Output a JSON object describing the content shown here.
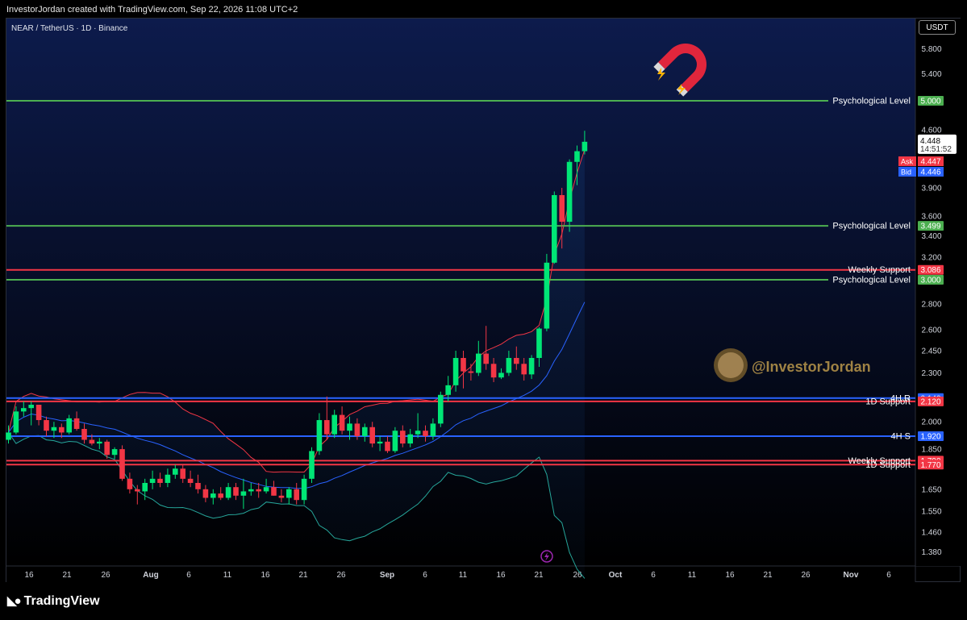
{
  "header": {
    "attribution": "InvestorJordan created with TradingView.com, Sep 22, 2026 11:08 UTC+2",
    "symbol": "NEAR / TetherUS · 1D · Binance",
    "currency": "USDT"
  },
  "footer": {
    "logo_text": "TradingView"
  },
  "watermark": "@InvestorJordan",
  "icons": {
    "magnet": "magnet-icon",
    "flash": "lightning-icon"
  },
  "colors": {
    "up": "#00e676",
    "down": "#f23645",
    "green_level": "#4caf50",
    "red_level": "#f23645",
    "blue_level": "#2962ff",
    "bg_top": "#0d1b4c",
    "bg_bottom": "#000000"
  },
  "chart_data": {
    "type": "candlestick",
    "price_axis": {
      "ticks": [
        "5.800",
        "5.400",
        "5.000",
        "4.600",
        "4.200",
        "3.900",
        "3.600",
        "3.400",
        "3.200",
        "3.000",
        "2.800",
        "2.600",
        "2.450",
        "2.300",
        "2.150",
        "2.000",
        "1.850",
        "1.650",
        "1.550",
        "1.460",
        "1.380"
      ]
    },
    "time_axis": {
      "ticks": [
        "16",
        "21",
        "26",
        "Aug",
        "6",
        "11",
        "16",
        "21",
        "26",
        "Sep",
        "6",
        "11",
        "16",
        "21",
        "26",
        "Oct",
        "6",
        "11",
        "16",
        "21",
        "26",
        "Nov",
        "6"
      ]
    },
    "last_price": {
      "value": "4.448",
      "countdown": "14:51:52"
    },
    "ask": {
      "label": "Ask",
      "value": "4.447"
    },
    "bid": {
      "label": "Bid",
      "value": "4.446"
    },
    "levels": [
      {
        "name": "Psychological Level",
        "price": 5.0,
        "label": "5.000",
        "kind": "green"
      },
      {
        "name": "Psychological Level",
        "price": 3.499,
        "label": "3.499",
        "kind": "green"
      },
      {
        "name": "Weekly Support",
        "price": 3.086,
        "label": "3.086",
        "kind": "red"
      },
      {
        "name": "Psychological Level",
        "price": 3.0,
        "label": "3.000",
        "kind": "green"
      },
      {
        "name": "4H R",
        "price": 2.14,
        "label": "2.140",
        "kind": "blue"
      },
      {
        "name": "1D Support",
        "price": 2.12,
        "label": "2.120",
        "kind": "red"
      },
      {
        "name": "4H S",
        "price": 1.92,
        "label": "1.920",
        "kind": "blue"
      },
      {
        "name": "Weekly Support",
        "price": 1.79,
        "label": "1.790",
        "kind": "red"
      },
      {
        "name": "1D Support",
        "price": 1.77,
        "label": "1.770",
        "kind": "red"
      }
    ],
    "candles": [
      [
        1.9,
        1.98,
        1.88,
        1.94
      ],
      [
        1.94,
        2.09,
        1.93,
        2.06
      ],
      [
        2.06,
        2.12,
        2.03,
        2.08
      ],
      [
        2.08,
        2.12,
        1.98,
        2.1
      ],
      [
        2.1,
        2.1,
        1.98,
        2.01
      ],
      [
        2.01,
        2.03,
        1.92,
        1.95
      ],
      [
        1.95,
        2.0,
        1.91,
        1.97
      ],
      [
        1.97,
        1.99,
        1.91,
        1.94
      ],
      [
        1.94,
        2.04,
        1.93,
        2.02
      ],
      [
        2.02,
        2.06,
        1.95,
        1.96
      ],
      [
        1.96,
        1.99,
        1.88,
        1.9
      ],
      [
        1.9,
        1.93,
        1.87,
        1.88
      ],
      [
        1.88,
        1.91,
        1.85,
        1.89
      ],
      [
        1.89,
        1.9,
        1.8,
        1.82
      ],
      [
        1.82,
        1.86,
        1.8,
        1.85
      ],
      [
        1.85,
        1.87,
        1.69,
        1.7
      ],
      [
        1.7,
        1.73,
        1.63,
        1.65
      ],
      [
        1.65,
        1.67,
        1.58,
        1.64
      ],
      [
        1.64,
        1.7,
        1.6,
        1.68
      ],
      [
        1.68,
        1.74,
        1.65,
        1.7
      ],
      [
        1.7,
        1.73,
        1.66,
        1.68
      ],
      [
        1.68,
        1.75,
        1.66,
        1.72
      ],
      [
        1.72,
        1.77,
        1.7,
        1.75
      ],
      [
        1.75,
        1.77,
        1.68,
        1.7
      ],
      [
        1.7,
        1.74,
        1.66,
        1.68
      ],
      [
        1.68,
        1.72,
        1.63,
        1.65
      ],
      [
        1.65,
        1.67,
        1.59,
        1.61
      ],
      [
        1.61,
        1.65,
        1.58,
        1.63
      ],
      [
        1.63,
        1.66,
        1.6,
        1.61
      ],
      [
        1.61,
        1.68,
        1.6,
        1.66
      ],
      [
        1.66,
        1.68,
        1.6,
        1.62
      ],
      [
        1.62,
        1.7,
        1.56,
        1.64
      ],
      [
        1.64,
        1.68,
        1.62,
        1.65
      ],
      [
        1.65,
        1.68,
        1.61,
        1.64
      ],
      [
        1.64,
        1.7,
        1.63,
        1.66
      ],
      [
        1.66,
        1.69,
        1.62,
        1.62
      ],
      [
        1.62,
        1.65,
        1.59,
        1.61
      ],
      [
        1.61,
        1.66,
        1.58,
        1.65
      ],
      [
        1.65,
        1.68,
        1.58,
        1.6
      ],
      [
        1.6,
        1.72,
        1.58,
        1.7
      ],
      [
        1.7,
        1.86,
        1.68,
        1.84
      ],
      [
        1.84,
        2.05,
        1.82,
        2.01
      ],
      [
        2.01,
        2.15,
        1.9,
        1.93
      ],
      [
        1.93,
        2.07,
        1.91,
        2.04
      ],
      [
        2.04,
        2.09,
        1.93,
        1.95
      ],
      [
        1.95,
        2.03,
        1.9,
        1.99
      ],
      [
        1.99,
        2.02,
        1.9,
        1.92
      ],
      [
        1.92,
        1.99,
        1.89,
        1.97
      ],
      [
        1.97,
        2.0,
        1.86,
        1.88
      ],
      [
        1.88,
        1.92,
        1.84,
        1.89
      ],
      [
        1.89,
        1.92,
        1.83,
        1.84
      ],
      [
        1.84,
        1.97,
        1.83,
        1.95
      ],
      [
        1.95,
        1.98,
        1.86,
        1.88
      ],
      [
        1.88,
        1.96,
        1.86,
        1.93
      ],
      [
        1.93,
        2.05,
        1.91,
        1.95
      ],
      [
        1.95,
        1.98,
        1.89,
        1.92
      ],
      [
        1.92,
        2.02,
        1.9,
        1.99
      ],
      [
        1.99,
        2.18,
        1.97,
        2.16
      ],
      [
        2.16,
        2.28,
        2.12,
        2.22
      ],
      [
        2.22,
        2.45,
        2.18,
        2.4
      ],
      [
        2.4,
        2.45,
        2.2,
        2.31
      ],
      [
        2.31,
        2.36,
        2.25,
        2.3
      ],
      [
        2.3,
        2.52,
        2.28,
        2.43
      ],
      [
        2.43,
        2.63,
        2.32,
        2.36
      ],
      [
        2.36,
        2.4,
        2.24,
        2.27
      ],
      [
        2.27,
        2.33,
        2.26,
        2.3
      ],
      [
        2.3,
        2.45,
        2.28,
        2.4
      ],
      [
        2.4,
        2.48,
        2.32,
        2.36
      ],
      [
        2.36,
        2.4,
        2.25,
        2.29
      ],
      [
        2.29,
        2.42,
        2.26,
        2.4
      ],
      [
        2.4,
        2.62,
        2.34,
        2.61
      ],
      [
        2.61,
        3.23,
        2.59,
        3.15
      ],
      [
        3.15,
        3.86,
        3.14,
        3.82
      ],
      [
        3.82,
        3.9,
        3.28,
        3.54
      ],
      [
        3.54,
        4.23,
        3.44,
        4.2
      ],
      [
        4.2,
        4.4,
        3.93,
        4.33
      ],
      [
        4.33,
        4.59,
        4.29,
        4.448
      ]
    ],
    "indicators": [
      {
        "type": "bollinger_upper",
        "color": "#f23645"
      },
      {
        "type": "bollinger_basis",
        "color": "#2962ff"
      },
      {
        "type": "bollinger_lower",
        "color": "#26a69a"
      }
    ]
  }
}
